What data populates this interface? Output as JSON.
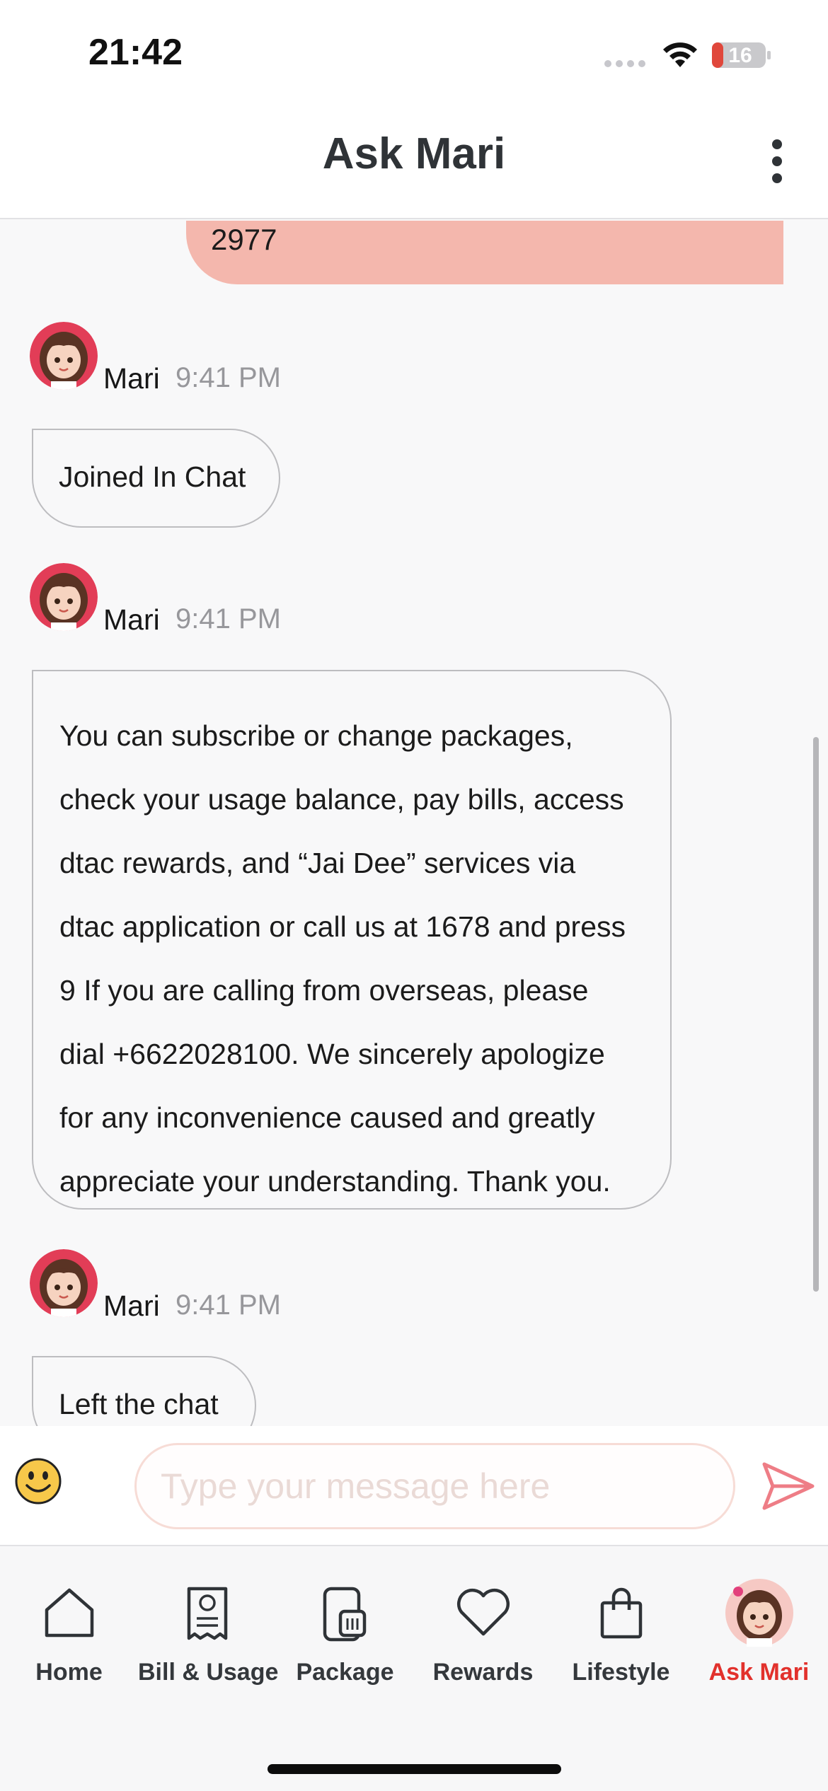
{
  "status_bar": {
    "time": "21:42",
    "battery": "16"
  },
  "header": {
    "title": "Ask Mari"
  },
  "chat": {
    "outgoing": {
      "text": "2977"
    },
    "messages": [
      {
        "sender": "Mari",
        "time": "9:41 PM",
        "text": "Joined In Chat"
      },
      {
        "sender": "Mari",
        "time": "9:41 PM",
        "lines": [
          "You can subscribe or change packages,",
          "check your usage balance, pay bills, access",
          "dtac rewards, and “Jai Dee” services via",
          "dtac application or call us at 1678 and press",
          "9 If you are calling from overseas, please",
          "dial +6622028100. We sincerely apologize",
          "for any inconvenience caused and greatly",
          "appreciate your understanding. Thank you."
        ]
      },
      {
        "sender": "Mari",
        "time": "9:41 PM",
        "text": "Left the chat"
      }
    ]
  },
  "composer": {
    "placeholder": "Type your message here",
    "value": ""
  },
  "nav": {
    "items": [
      {
        "label": "Home",
        "icon": "home-icon"
      },
      {
        "label": "Bill & Usage",
        "icon": "bill-icon"
      },
      {
        "label": "Package",
        "icon": "package-icon"
      },
      {
        "label": "Rewards",
        "icon": "heart-icon"
      },
      {
        "label": "Lifestyle",
        "icon": "shopping-bag-icon"
      },
      {
        "label": "Ask Mari",
        "icon": "mari-avatar-icon",
        "active": true
      }
    ]
  },
  "colors": {
    "accent": "#e2312c",
    "outgoing_bubble": "#f4b7ad",
    "title": "#2f3337"
  }
}
